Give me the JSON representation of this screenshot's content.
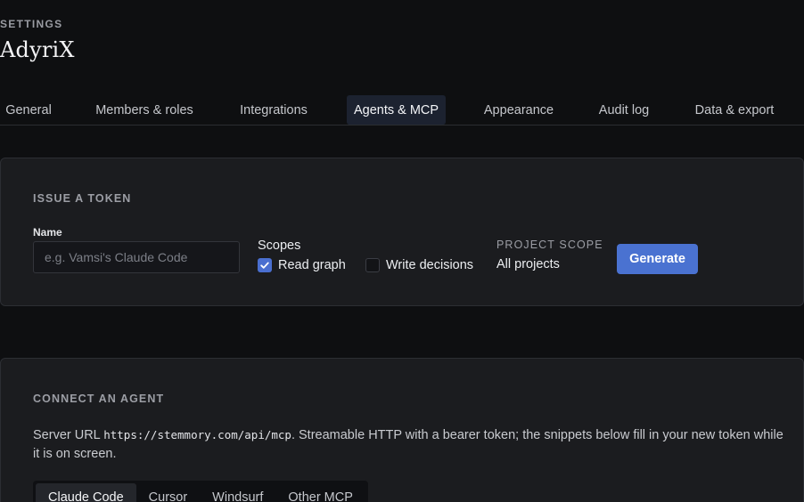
{
  "header": {
    "eyebrow": "SETTINGS",
    "org_name": "AdyriX"
  },
  "tabs": [
    {
      "label": "General",
      "active": false
    },
    {
      "label": "Members & roles",
      "active": false
    },
    {
      "label": "Integrations",
      "active": false
    },
    {
      "label": "Agents & MCP",
      "active": true
    },
    {
      "label": "Appearance",
      "active": false
    },
    {
      "label": "Audit log",
      "active": false
    },
    {
      "label": "Data & export",
      "active": false
    }
  ],
  "issue_token": {
    "title": "ISSUE A TOKEN",
    "name_label": "Name",
    "name_value": "",
    "name_placeholder": "e.g. Vamsi's Claude Code",
    "scopes_label": "Scopes",
    "scopes": [
      {
        "label": "Read graph",
        "checked": true
      },
      {
        "label": "Write decisions",
        "checked": false
      }
    ],
    "project_scope_label": "PROJECT SCOPE",
    "project_scope_value": "All projects",
    "generate_label": "Generate"
  },
  "connect_agent": {
    "title": "CONNECT AN AGENT",
    "server_prefix": "Server URL ",
    "server_url": "https://stemmory.com/api/mcp",
    "server_suffix": ". Streamable HTTP with a bearer token; the snippets below fill in your new token while it is on screen.",
    "agent_tabs": [
      {
        "label": "Claude Code",
        "active": true
      },
      {
        "label": "Cursor",
        "active": false
      },
      {
        "label": "Windsurf",
        "active": false
      },
      {
        "label": "Other MCP",
        "active": false
      }
    ]
  },
  "colors": {
    "background": "#0e0f11",
    "card": "#1b1c1f",
    "accent": "#4a72d1",
    "active_tab": "#1c2230"
  },
  "icons": {
    "checkbox_checked": "check-icon"
  }
}
